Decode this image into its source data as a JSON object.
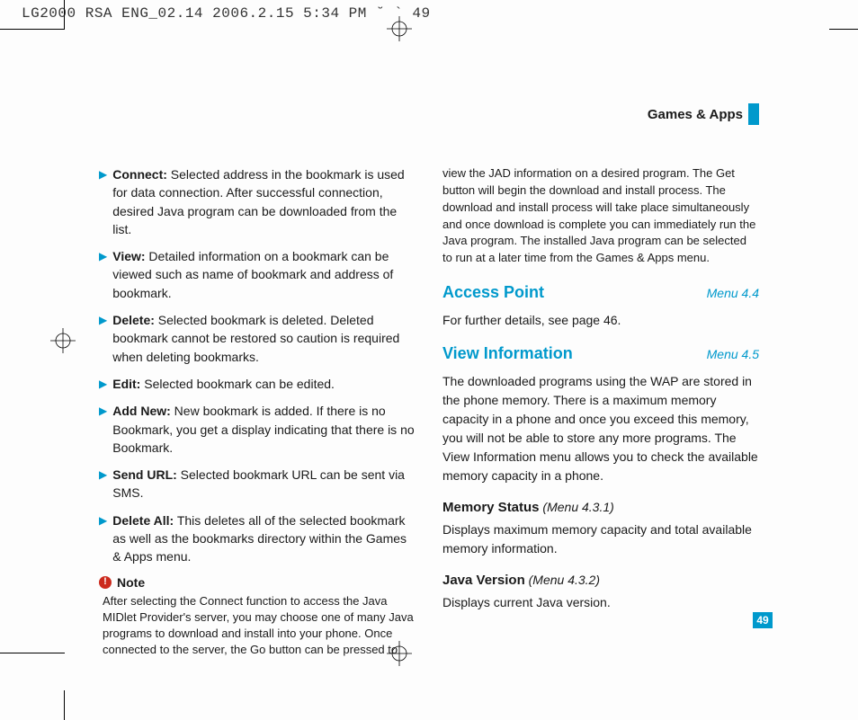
{
  "print_header": "LG2000 RSA ENG_02.14  2006.2.15 5:34 PM  ˘   ` 49",
  "section": {
    "title": "Games & Apps"
  },
  "left_col": {
    "bullets": [
      {
        "bold": "Connect:",
        "text": " Selected address in the bookmark is used for data connection. After successful connection, desired Java program can be downloaded from the list."
      },
      {
        "bold": "View:",
        "text": " Detailed information on a bookmark can be viewed such as name of bookmark and address of bookmark."
      },
      {
        "bold": "Delete:",
        "text": " Selected bookmark is deleted. Deleted bookmark cannot be restored so caution is required when deleting bookmarks."
      },
      {
        "bold": "Edit:",
        "text": " Selected bookmark can be edited."
      },
      {
        "bold": "Add New:",
        "text": " New bookmark is added. If there is no Bookmark, you get a display indicating that there is no Bookmark."
      },
      {
        "bold": "Send URL:",
        "text": " Selected bookmark URL can be sent via SMS."
      },
      {
        "bold": "Delete All:",
        "text": " This deletes all of the selected bookmark as well as the bookmarks directory within the Games & Apps menu."
      }
    ],
    "note": {
      "label": "Note",
      "body": "After selecting the Connect function to access the Java MIDlet Provider's server, you may choose one of many Java programs to download and install into your phone. Once connected to the server, the Go button can be pressed to"
    }
  },
  "right_col": {
    "continued": "view the JAD information on a desired program. The Get button will begin the download and install process. The download and install process will take place simultaneously and once download is complete you can immediately run the Java program. The installed Java program can be selected to run at a later time from the Games & Apps menu.",
    "access_point": {
      "title": "Access Point",
      "menu": "Menu 4.4",
      "body": "For further details, see page 46."
    },
    "view_info": {
      "title": "View Information",
      "menu": "Menu 4.5",
      "body": "The downloaded programs using the WAP are stored in the phone memory. There is a maximum memory capacity in a phone and once you exceed this memory, you will not be able to store any more programs. The View Information menu allows you to check the available memory capacity in a phone."
    },
    "memory_status": {
      "title": "Memory Status",
      "ref": "(Menu 4.3.1)",
      "body": "Displays maximum memory capacity and total available memory information."
    },
    "java_version": {
      "title": "Java Version",
      "ref": "(Menu 4.3.2)",
      "body": "Displays current Java version."
    }
  },
  "page_number": "49"
}
